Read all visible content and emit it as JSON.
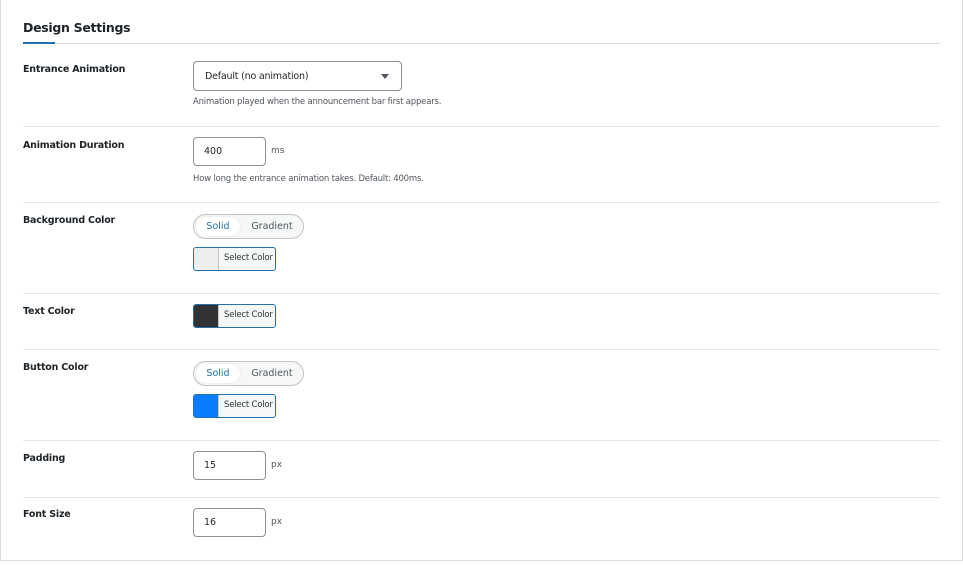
{
  "title": "Design Settings",
  "rows": {
    "entrance": {
      "label": "Entrance Animation",
      "value": "Default (no animation)",
      "help": "Animation played when the announcement bar first appears."
    },
    "duration": {
      "label": "Animation Duration",
      "value": "400",
      "unit": "ms",
      "help": "How long the entrance animation takes. Default: 400ms."
    },
    "bg": {
      "label": "Background Color",
      "solid": "Solid",
      "gradient": "Gradient",
      "button": "Select Color",
      "color": "#eeeeee"
    },
    "text": {
      "label": "Text Color",
      "button": "Select Color",
      "color": "#333333"
    },
    "btn": {
      "label": "Button Color",
      "solid": "Solid",
      "gradient": "Gradient",
      "button": "Select Color",
      "color": "#0a7cff"
    },
    "padding": {
      "label": "Padding",
      "value": "15",
      "unit": "px"
    },
    "font": {
      "label": "Font Size",
      "value": "16",
      "unit": "px"
    }
  }
}
